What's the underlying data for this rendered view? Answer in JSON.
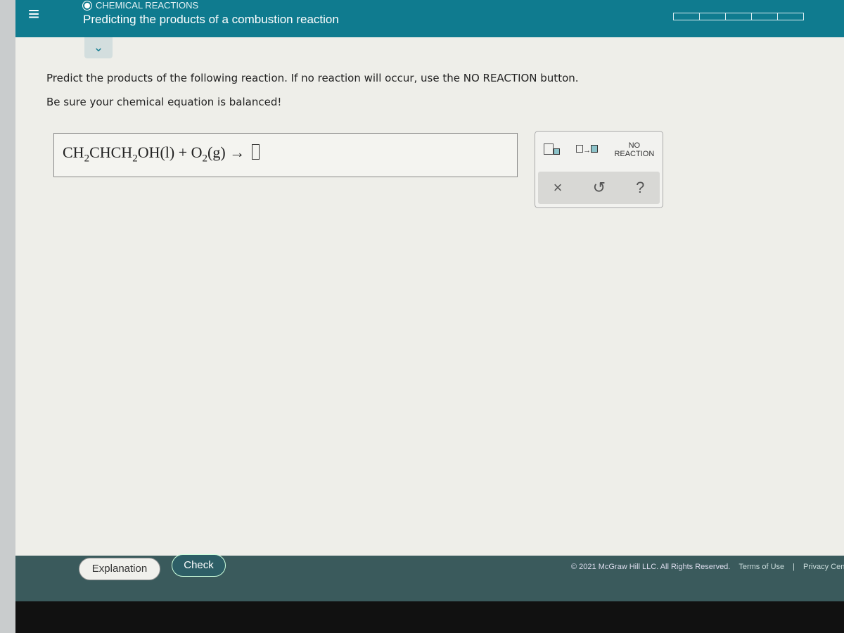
{
  "header": {
    "topic": "CHEMICAL REACTIONS",
    "title": "Predicting the products of a combustion reaction",
    "progress_segments": 5
  },
  "question": {
    "line1": "Predict the products of the following reaction. If no reaction will occur, use the NO REACTION button.",
    "line2": "Be sure your chemical equation is balanced!"
  },
  "equation": {
    "r1a": "CH",
    "s1": "2",
    "r1b": "CHCH",
    "s2": "2",
    "r1c": "OH",
    "state1": "(l)",
    "plus": " + ",
    "r2": "O",
    "s3": "2",
    "state2": "(g)",
    "arrow": " → "
  },
  "tools": {
    "no_reaction_1": "NO",
    "no_reaction_2": "REACTION",
    "clear": "×",
    "undo": "↺",
    "help": "?"
  },
  "buttons": {
    "explanation": "Explanation",
    "check": "Check"
  },
  "footer": {
    "copyright": "© 2021 McGraw Hill LLC. All Rights Reserved.",
    "terms": "Terms of Use",
    "sep": "|",
    "privacy": "Privacy Center"
  },
  "colors": {
    "header": "#0f7b8f",
    "check_button": "#2d5e66"
  }
}
